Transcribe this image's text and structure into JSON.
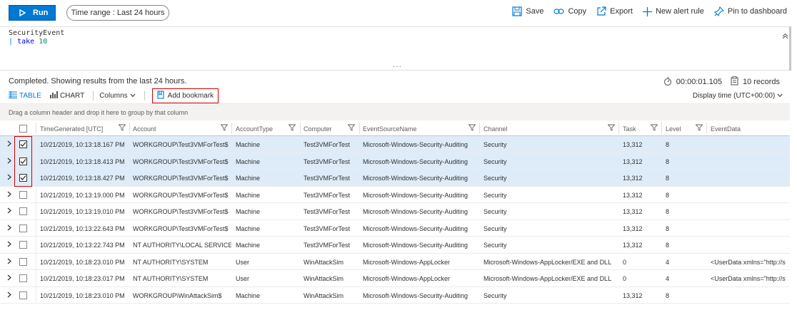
{
  "toolbar": {
    "run_label": "Run",
    "time_range_label": "Time range : Last 24 hours",
    "save_label": "Save",
    "copy_label": "Copy",
    "export_label": "Export",
    "new_alert_label": "New alert rule",
    "pin_label": "Pin to dashboard"
  },
  "query": {
    "line1": "SecurityEvent",
    "line2_bar": "|",
    "line2_kw": "take",
    "line2_num": "10"
  },
  "results": {
    "status": "Completed. Showing results from the last 24 hours.",
    "duration": "00:00:01.105",
    "records": "10 records",
    "table_label": "TABLE",
    "chart_label": "CHART",
    "columns_label": "Columns",
    "bookmark_label": "Add bookmark",
    "display_time": "Display time (UTC+00:00)",
    "group_hint": "Drag a column header and drop it here to group by that column"
  },
  "columns": [
    "TimeGenerated [UTC]",
    "Account",
    "AccountType",
    "Computer",
    "EventSourceName",
    "Channel",
    "Task",
    "Level",
    "EventData"
  ],
  "rows": [
    {
      "checked": true,
      "cells": [
        "10/21/2019, 10:13:18.167 PM",
        "WORKGROUP\\Test3VMForTest$",
        "Machine",
        "Test3VMForTest",
        "Microsoft-Windows-Security-Auditing",
        "Security",
        "13,312",
        "8",
        ""
      ]
    },
    {
      "checked": true,
      "cells": [
        "10/21/2019, 10:13:18.413 PM",
        "WORKGROUP\\Test3VMForTest$",
        "Machine",
        "Test3VMForTest",
        "Microsoft-Windows-Security-Auditing",
        "Security",
        "13,312",
        "8",
        ""
      ]
    },
    {
      "checked": true,
      "cells": [
        "10/21/2019, 10:13:18.427 PM",
        "WORKGROUP\\Test3VMForTest$",
        "Machine",
        "Test3VMForTest",
        "Microsoft-Windows-Security-Auditing",
        "Security",
        "13,312",
        "8",
        ""
      ]
    },
    {
      "checked": false,
      "cells": [
        "10/21/2019, 10:13:19.000 PM",
        "WORKGROUP\\Test3VMForTest$",
        "Machine",
        "Test3VMForTest",
        "Microsoft-Windows-Security-Auditing",
        "Security",
        "13,312",
        "8",
        ""
      ]
    },
    {
      "checked": false,
      "cells": [
        "10/21/2019, 10:13:19.010 PM",
        "WORKGROUP\\Test3VMForTest$",
        "Machine",
        "Test3VMForTest",
        "Microsoft-Windows-Security-Auditing",
        "Security",
        "13,312",
        "8",
        ""
      ]
    },
    {
      "checked": false,
      "cells": [
        "10/21/2019, 10:13:22.643 PM",
        "WORKGROUP\\Test3VMForTest$",
        "Machine",
        "Test3VMForTest",
        "Microsoft-Windows-Security-Auditing",
        "Security",
        "13,312",
        "8",
        ""
      ]
    },
    {
      "checked": false,
      "cells": [
        "10/21/2019, 10:13:22.743 PM",
        "NT AUTHORITY\\LOCAL SERVICE",
        "Machine",
        "Test3VMForTest",
        "Microsoft-Windows-Security-Auditing",
        "Security",
        "13,312",
        "8",
        ""
      ]
    },
    {
      "checked": false,
      "cells": [
        "10/21/2019, 10:18:23.010 PM",
        "NT AUTHORITY\\SYSTEM",
        "User",
        "WinAttackSim",
        "Microsoft-Windows-AppLocker",
        "Microsoft-Windows-AppLocker/EXE and DLL",
        "0",
        "4",
        "<UserData xmlns=\"http://s"
      ]
    },
    {
      "checked": false,
      "cells": [
        "10/21/2019, 10:18:23.017 PM",
        "NT AUTHORITY\\SYSTEM",
        "User",
        "WinAttackSim",
        "Microsoft-Windows-AppLocker",
        "Microsoft-Windows-AppLocker/EXE and DLL",
        "0",
        "4",
        "<UserData xmlns=\"http://s"
      ]
    },
    {
      "checked": false,
      "cells": [
        "10/21/2019, 10:18:23.010 PM",
        "WORKGROUP\\WinAttackSim$",
        "Machine",
        "WinAttackSim",
        "Microsoft-Windows-Security-Auditing",
        "Security",
        "13,312",
        "8",
        ""
      ]
    }
  ],
  "colors": {
    "accent": "#0078d4",
    "highlight": "#d00000",
    "selected_row": "#deecf9"
  }
}
